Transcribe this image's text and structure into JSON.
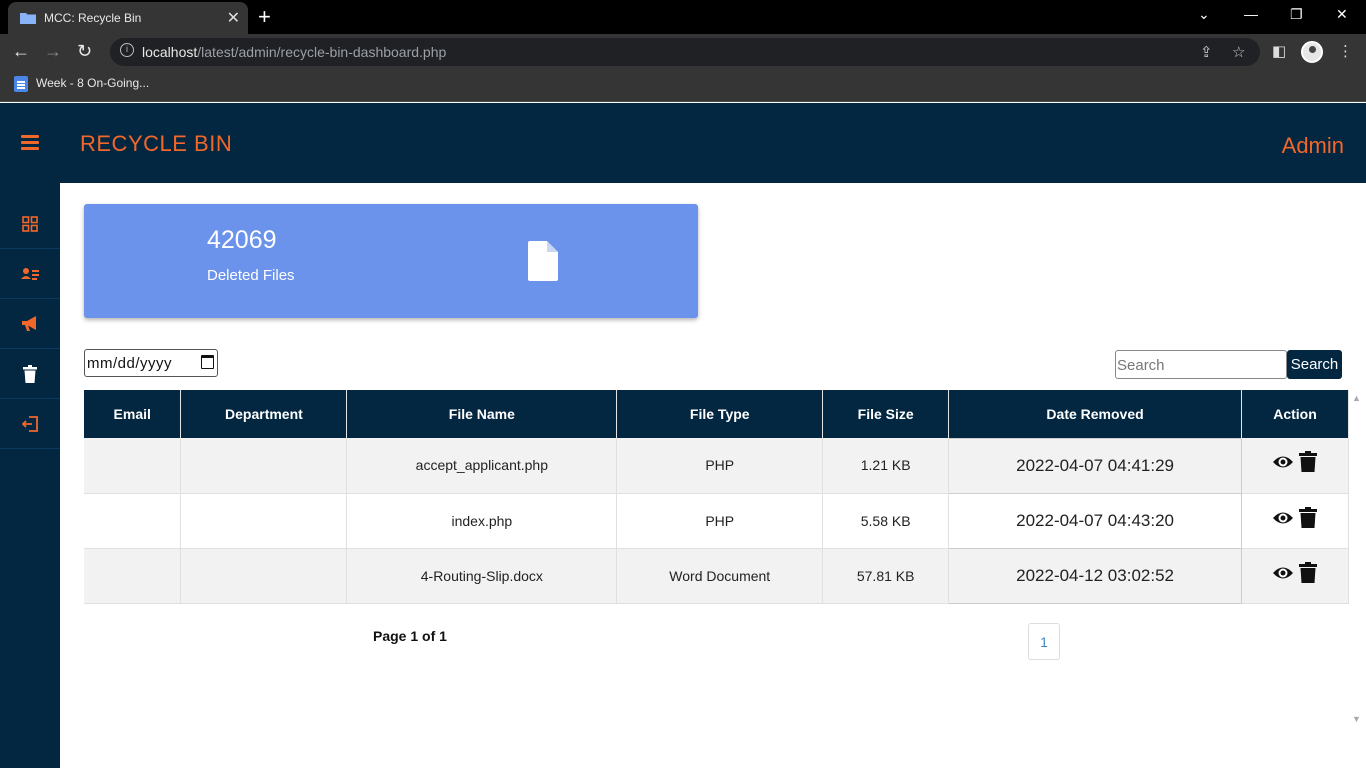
{
  "browser": {
    "tab_title": "MCC: Recycle Bin",
    "url_host": "localhost",
    "url_path": "/latest/admin/recycle-bin-dashboard.php",
    "bookmark": "Week - 8 On-Going..."
  },
  "header": {
    "title": "RECYCLE BIN",
    "user": "Admin"
  },
  "sidebar": {
    "items": [
      {
        "icon": "dashboard-grid-icon"
      },
      {
        "icon": "user-list-icon"
      },
      {
        "icon": "megaphone-icon"
      },
      {
        "icon": "trash-icon"
      },
      {
        "icon": "logout-icon"
      }
    ]
  },
  "stats": {
    "count": "42069",
    "label": "Deleted Files",
    "icon": "file-icon"
  },
  "filters": {
    "date_placeholder": "mm/dd/yyyy",
    "search_placeholder": "Search",
    "search_button": "Search"
  },
  "table": {
    "headers": [
      "Email",
      "Department",
      "File Name",
      "File Type",
      "File Size",
      "Date Removed",
      "Action"
    ],
    "rows": [
      {
        "email": "",
        "department": "",
        "file_name": "accept_applicant.php",
        "file_type": "PHP",
        "file_size": "1.21 KB",
        "date_removed": "2022-04-07 04:41:29"
      },
      {
        "email": "",
        "department": "",
        "file_name": "index.php",
        "file_type": "PHP",
        "file_size": "5.58 KB",
        "date_removed": "2022-04-07 04:43:20"
      },
      {
        "email": "",
        "department": "",
        "file_name": "4-Routing-Slip.docx",
        "file_type": "Word Document",
        "file_size": "57.81 KB",
        "date_removed": "2022-04-12 03:02:52"
      }
    ]
  },
  "pagination": {
    "info": "Page 1 of 1",
    "current": "1"
  },
  "colors": {
    "navy": "#032641",
    "accent": "#f2672a",
    "card": "#6b93ec"
  }
}
